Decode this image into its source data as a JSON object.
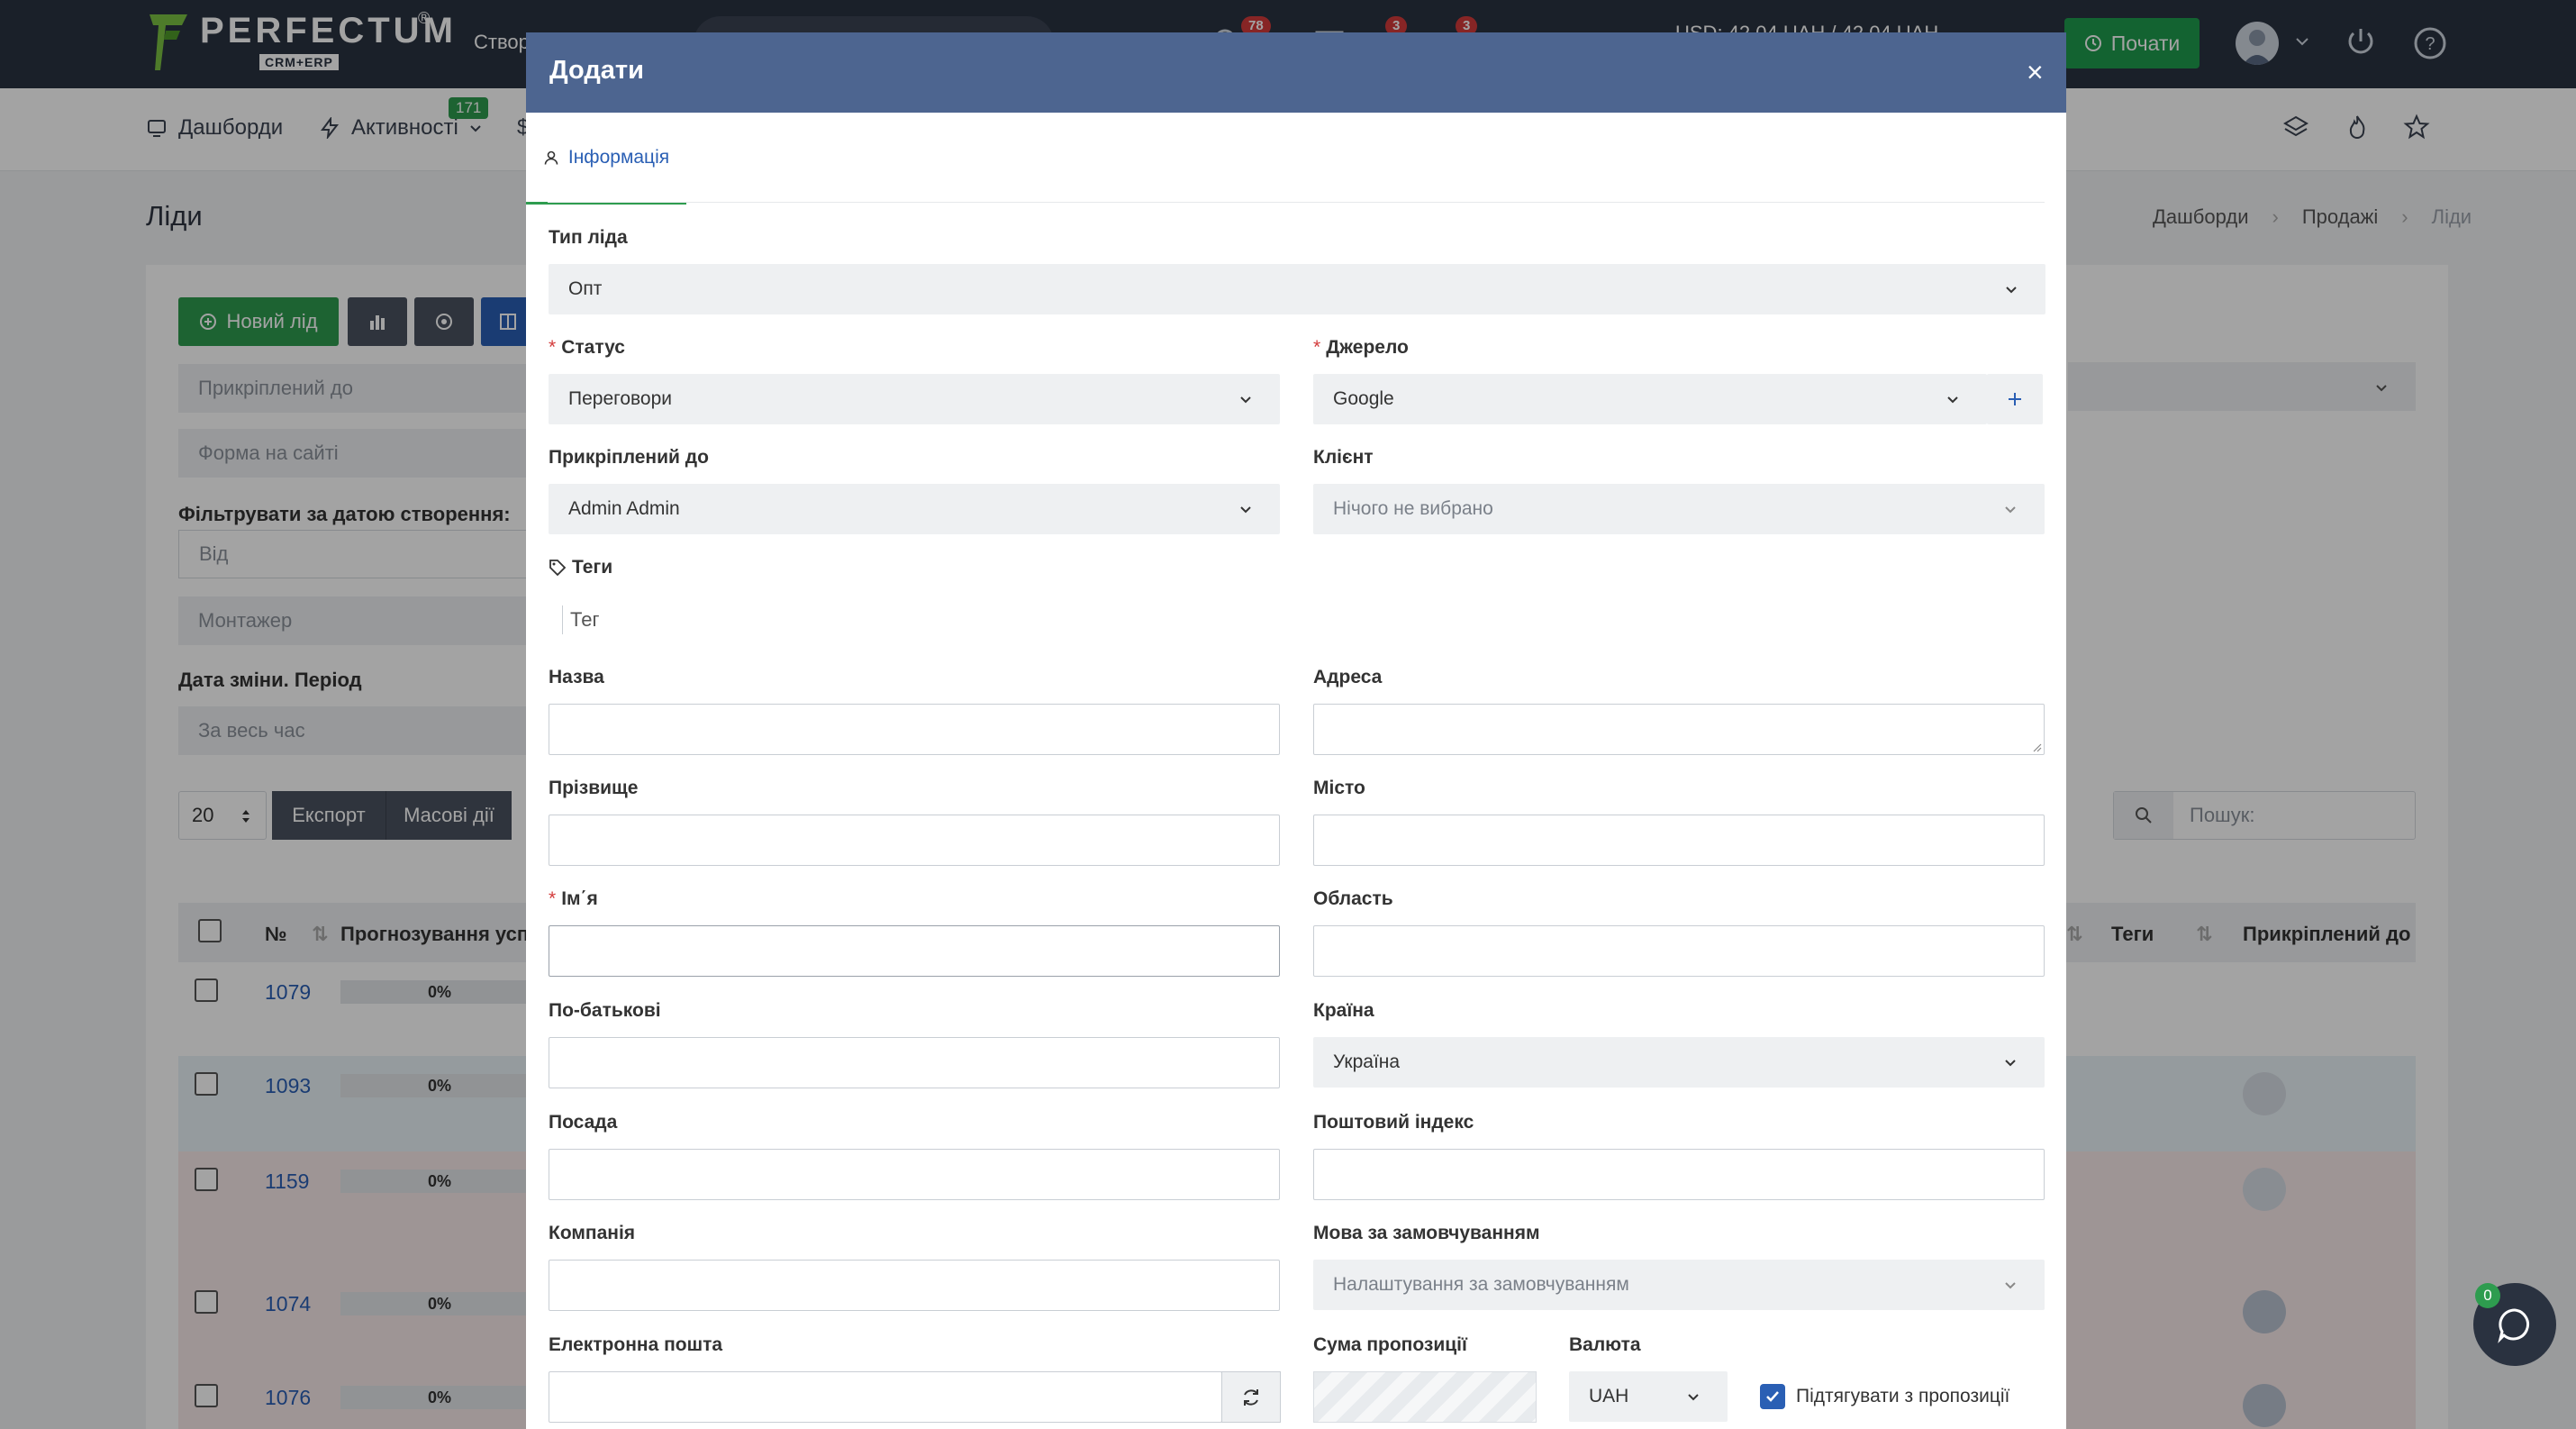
{
  "app": {
    "logo_text": "PERFECTUM",
    "logo_sub": "CRM+ERP",
    "logo_reg": "®",
    "create_label": "Створ",
    "currency": "USD: 42.04 UAH / 42.04 UAH",
    "badges": [
      "78",
      "3",
      "3"
    ],
    "start_label": "Почати"
  },
  "nav": {
    "dashboards": "Дашборди",
    "activities": "Активності",
    "activities_badge": "171",
    "extra": "$"
  },
  "page": {
    "title": "Ліди",
    "breadcrumb": [
      "Дашборди",
      "Продажі",
      "Ліди"
    ]
  },
  "toolbar": {
    "new_lead": "Новий лід"
  },
  "filters": {
    "attached_to": "Прикріплений до",
    "site_form": "Форма на сайті",
    "date_filter_label": "Фільтрувати за датою створення:",
    "from": "Від",
    "installer": "Монтажер",
    "change_date_label": "Дата зміни. Період",
    "all_time": "За весь час"
  },
  "table_controls": {
    "per_page": "20",
    "export": "Експорт",
    "bulk": "Масові дії",
    "search_placeholder": "Пошук:"
  },
  "table": {
    "headers": {
      "num": "№",
      "forecast": "Прогнозування успіх",
      "tags": "Теги",
      "attached": "Прикріплений до"
    },
    "rows": [
      {
        "id": "1079",
        "progress": "0%"
      },
      {
        "id": "1093",
        "progress": "0%"
      },
      {
        "id": "1159",
        "progress": "0%"
      },
      {
        "id": "1074",
        "progress": "0%"
      },
      {
        "id": "1076",
        "progress": "0%"
      }
    ]
  },
  "chat_badge": "0",
  "modal": {
    "title": "Додати",
    "close": "×",
    "tab_info": "Інформація",
    "lead_type": {
      "label": "Тип ліда",
      "value": "Опт"
    },
    "status": {
      "label": "Статус",
      "value": "Переговори"
    },
    "source": {
      "label": "Джерело",
      "value": "Google"
    },
    "attached_to": {
      "label": "Прикріплений до",
      "value": "Admin Admin"
    },
    "client": {
      "label": "Клієнт",
      "value": "Нічого не вибрано"
    },
    "tags": {
      "label": "Теги",
      "placeholder": "Тег"
    },
    "name_label": "Назва",
    "address_label": "Адреса",
    "surname_label": "Прізвище",
    "city_label": "Місто",
    "first_name_label": "Ім΄я",
    "region_label": "Область",
    "patronymic_label": "По-батькові",
    "country": {
      "label": "Країна",
      "value": "Україна"
    },
    "position_label": "Посада",
    "postal_label": "Поштовий індекс",
    "company_label": "Компанія",
    "language": {
      "label": "Мова за замовчуванням",
      "value": "Налаштування за замовчуванням"
    },
    "email_label": "Електронна пошта",
    "offer_sum_label": "Сума пропозиції",
    "currency": {
      "label": "Валюта",
      "value": "UAH"
    },
    "pull_from_offers": "Підтягувати з пропозиції"
  }
}
